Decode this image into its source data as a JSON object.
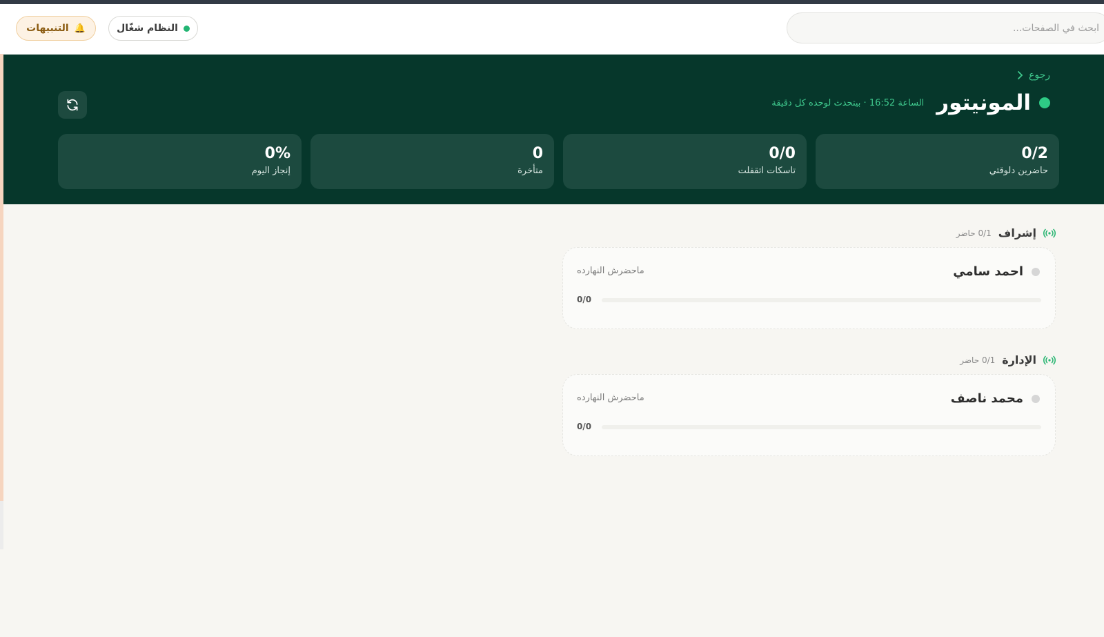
{
  "topbar": {
    "search_placeholder": "ابحث في الصفحات...",
    "system_status": "النظام شغّال",
    "alerts_label": "التنبيهات",
    "alerts_icon": "bell-icon"
  },
  "header": {
    "back_label": "رجوع",
    "title": "المونيتور",
    "subtitle": "الساعة 16:52 · بيتحدث لوحده كل دقيقة",
    "refresh_icon": "refresh-icon"
  },
  "stats": [
    {
      "value": "0/2",
      "label": "حاضرين دلوقتي"
    },
    {
      "value": "0/0",
      "label": "تاسكات اتقفلت"
    },
    {
      "value": "0",
      "label": "متأخرة"
    },
    {
      "value": "0%",
      "label": "إنجاز اليوم"
    }
  ],
  "sections": [
    {
      "title": "إشراف",
      "count": "0/1 حاضر",
      "members": [
        {
          "name": "احمد سامي",
          "status": "ماحضرش النهارده",
          "ratio": "0/0",
          "progress": 0
        }
      ]
    },
    {
      "title": "الإدارة",
      "count": "0/1 حاضر",
      "members": [
        {
          "name": "محمد ناصف",
          "status": "ماحضرش النهارده",
          "ratio": "0/0",
          "progress": 0
        }
      ]
    }
  ],
  "colors": {
    "band": "#06372b",
    "accent": "#2ecb85",
    "stat_card": "#1c4a3f",
    "alerts_bg": "#fdf2e4"
  }
}
